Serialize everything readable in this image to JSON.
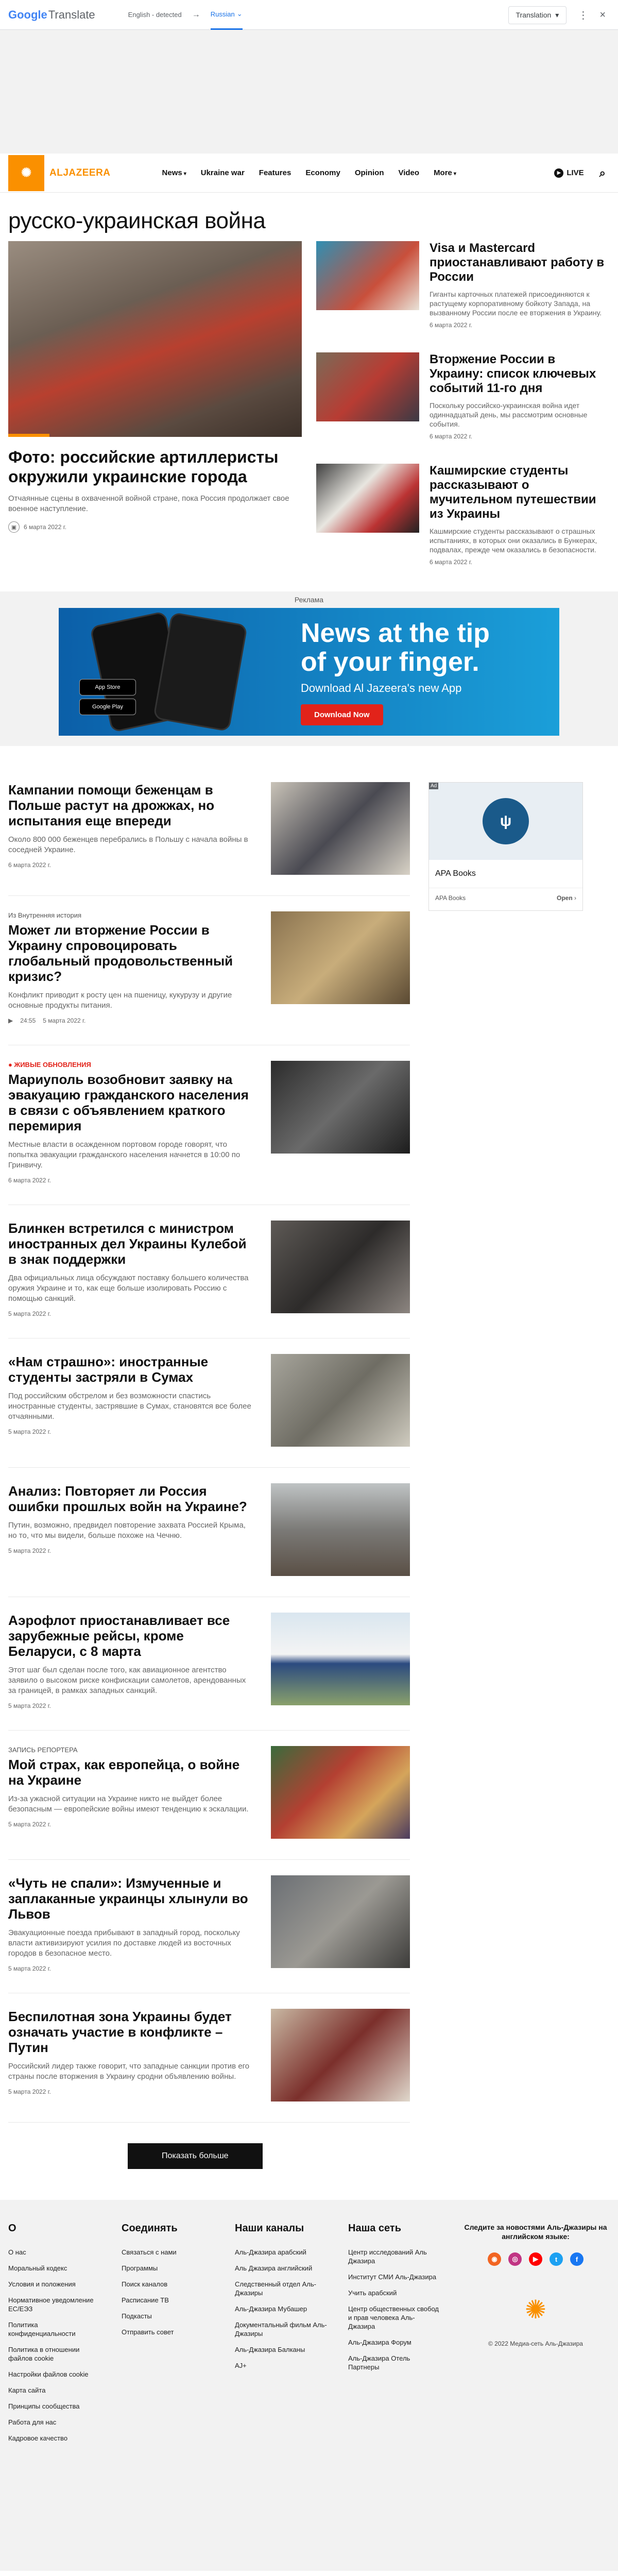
{
  "translate_bar": {
    "logo_google": "Google",
    "logo_translate": "Translate",
    "source_lang": "English - detected",
    "arrow": "→",
    "target_lang": "Russian",
    "target_caret": "⌄",
    "translation_button": "Translation",
    "more_icon": "⋮",
    "close_icon": "×"
  },
  "nav": {
    "logo_text": "ALJAZEERA",
    "links": [
      "News",
      "Ukraine war",
      "Features",
      "Economy",
      "Opinion",
      "Video",
      "More"
    ],
    "live": "LIVE"
  },
  "page_title": "русско-украинская война",
  "hero": {
    "title": "Фото: российские артиллеристы окружили украинские города",
    "desc": "Отчаянные сцены в охваченной войной стране, пока Россия продолжает свое военное наступление.",
    "date": "6 марта 2022 г."
  },
  "side": [
    {
      "title": "Visa и Mastercard приостанавливают работу в России",
      "desc": "Гиганты карточных платежей присоединяются к растущему корпоративному бойкоту Запада, на вызванному России после ее вторжения в Украину.",
      "date": "6 марта 2022 г."
    },
    {
      "title": "Вторжение России в Украину: список ключевых событий 11-го дня",
      "desc": "Поскольку российско-украинская война идет одиннадцатый день, мы рассмотрим основные события.",
      "date": "6 марта 2022 г."
    },
    {
      "title": "Кашмирские студенты рассказывают о мучительном путешествии из Украины",
      "desc": "Кашмирские студенты рассказывают о страшных испытаниях, в которых они оказались в Бункерах, подвалах, прежде чем оказались в безопасности.",
      "date": "6 марта 2022 г."
    }
  ],
  "ad_label": "Реклама",
  "banner": {
    "headline_1": "News at the tip",
    "headline_2": "of your finger.",
    "sub": "Download Al Jazeera's new App",
    "cta": "Download Now",
    "app_store": "App Store",
    "google_play": "Google Play",
    "phone_logo": "ALJAZEERA"
  },
  "articles": [
    {
      "kicker": "",
      "live": "",
      "title": "Кампании помощи беженцам в Польше растут на дрожжах, но испытания еще впереди",
      "desc": "Около 800 000 беженцев перебрались в Польшу с начала войны в соседней Украине.",
      "date": "6 марта 2022 г.",
      "duration": ""
    },
    {
      "kicker": "Из Внутренняя история",
      "live": "",
      "title": "Может ли вторжение России в Украину спровоцировать глобальный продовольственный кризис?",
      "desc": "Конфликт приводит к росту цен на пшеницу, кукурузу и другие основные продукты питания.",
      "date": "5 марта 2022 г.",
      "duration": "24:55"
    },
    {
      "kicker": "",
      "live": "ЖИВЫЕ ОБНОВЛЕНИЯ",
      "title": "Мариуполь возобновит заявку на эвакуацию гражданского населения в связи с объявлением краткого перемирия",
      "desc": "Местные власти в осажденном портовом городе говорят, что попытка эвакуации гражданского населения начнется в 10:00 по Гринвичу.",
      "date": "6 марта 2022 г.",
      "duration": ""
    },
    {
      "kicker": "",
      "live": "",
      "title": "Блинкен встретился с министром иностранных дел Украины Кулебой в знак поддержки",
      "desc": "Два официальных лица обсуждают поставку большего количества оружия Украине и то, как еще больше изолировать Россию с помощью санкций.",
      "date": "5 марта 2022 г.",
      "duration": ""
    },
    {
      "kicker": "",
      "live": "",
      "title": "«Нам страшно»: иностранные студенты застряли в Сумах",
      "desc": "Под российским обстрелом и без возможности спастись иностранные студенты, застрявшие в Сумах, становятся все более отчаянными.",
      "date": "5 марта 2022 г.",
      "duration": ""
    },
    {
      "kicker": "",
      "live": "",
      "title": "Анализ: Повторяет ли Россия ошибки прошлых войн на Украине?",
      "desc": "Путин, возможно, предвидел повторение захвата Россией Крыма, но то, что мы видели, больше похоже на Чечню.",
      "date": "5 марта 2022 г.",
      "duration": ""
    },
    {
      "kicker": "",
      "live": "",
      "title": "Аэрофлот приостанавливает все зарубежные рейсы, кроме Беларуси, с 8 марта",
      "desc": "Этот шаг был сделан после того, как авиационное агентство заявило о высоком риске конфискации самолетов, арендованных за границей, в рамках западных санкций.",
      "date": "5 марта 2022 г.",
      "duration": ""
    },
    {
      "kicker": "ЗАПИСЬ РЕПОРТЕРА",
      "live": "",
      "title": "Мой страх, как европейца, о войне на Украине",
      "desc": "Из-за ужасной ситуации на Украине никто не выйдет более безопасным — европейские войны имеют тенденцию к эскалации.",
      "date": "5 марта 2022 г.",
      "duration": ""
    },
    {
      "kicker": "",
      "live": "",
      "title": "«Чуть не спали»: Измученные и заплаканные украинцы хлынули во Львов",
      "desc": "Эвакуационные поезда прибывают в западный город, поскольку власти активизируют усилия по доставке людей из восточных городов в безопасное место.",
      "date": "5 марта 2022 г.",
      "duration": ""
    },
    {
      "kicker": "",
      "live": "",
      "title": "Беспилотная зона Украины будет означать участие в конфликте – Путин",
      "desc": "Российский лидер также говорит, что западные санкции против его страны после вторжения в Украину сродни объявлению войны.",
      "date": "5 марта 2022 г.",
      "duration": ""
    }
  ],
  "side_ad": {
    "tag": "Ad",
    "name": "APA Books",
    "sub": "APA Books",
    "open": "Open"
  },
  "show_more": "Показать больше",
  "footer": {
    "cols": [
      {
        "title": "О",
        "items": [
          "О нас",
          "Моральный кодекс",
          "Условия и положения",
          "Нормативное уведомление ЕС/ЕЭЗ",
          "Политика конфиденциальности",
          "Политика в отношении файлов cookie",
          "Настройки файлов cookie",
          "Карта сайта",
          "Принципы сообщества",
          "Работа для нас",
          "Кадровое качество"
        ]
      },
      {
        "title": "Соединять",
        "items": [
          "Связаться с нами",
          "Программы",
          "Поиск каналов",
          "Расписание ТВ",
          "Подкасты",
          "Отправить совет"
        ]
      },
      {
        "title": "Наши каналы",
        "items": [
          "Аль-Джазира арабский",
          "Аль Джазира английский",
          "Следственный отдел Аль-Джазиры",
          "Аль-Джазира Мубашер",
          "Документальный фильм Аль-Джазиры",
          "Аль-Джазира Балканы",
          "AJ+"
        ]
      },
      {
        "title": "Наша сеть",
        "items": [
          "Центр исследований Аль Джазира",
          "Институт СМИ Аль-Джазира",
          "Учить арабский",
          "Центр общественных свобод и прав человека Аль-Джазира",
          "Аль-Джазира Форум",
          "Аль-Джазира Отель Партнеры"
        ]
      }
    ],
    "social_title": "Следите за новостями Аль-Джазиры на английском языке:",
    "copyright": "© 2022 Медиа-сеть Аль-Джазира"
  },
  "colors": {
    "brand": "#fa9000",
    "live": "#e2231a",
    "link_blue": "#1a73e8"
  }
}
